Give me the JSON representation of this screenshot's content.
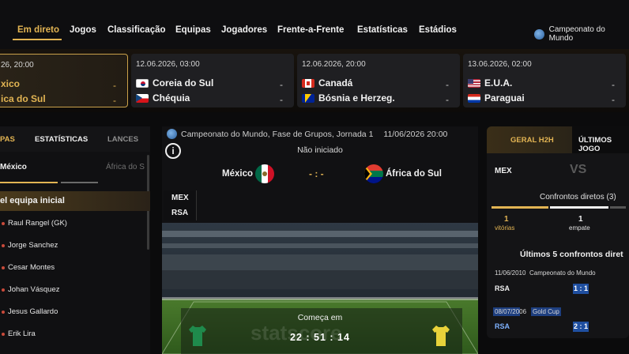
{
  "nav": {
    "items": [
      {
        "label": "Em direto",
        "active": true
      },
      {
        "label": "Jogos"
      },
      {
        "label": "Classificação"
      },
      {
        "label": "Equipas"
      },
      {
        "label": "Jogadores"
      },
      {
        "label": "Frente-a-Frente"
      },
      {
        "label": "Estatísticas"
      },
      {
        "label": "Estádios"
      }
    ],
    "competition": "Campeonato do Mundo"
  },
  "matches": [
    {
      "date": "26, 20:00",
      "home": "xico",
      "away": "ica do Sul",
      "home_score": "-",
      "away_score": "-",
      "active": true
    },
    {
      "date": "12.06.2026, 03:00",
      "home": "Coreia do Sul",
      "away": "Chéquia",
      "home_score": "-",
      "away_score": "-"
    },
    {
      "date": "12.06.2026, 20:00",
      "home": "Canadá",
      "away": "Bósnia e Herzeg.",
      "home_score": "-",
      "away_score": "-"
    },
    {
      "date": "13.06.2026, 02:00",
      "home": "E.U.A.",
      "away": "Paraguai",
      "home_score": "-",
      "away_score": "-"
    }
  ],
  "left_panel": {
    "tabs": [
      "PAS",
      "ESTATÍSTICAS",
      "LANCES"
    ],
    "team_home": "México",
    "team_away": "África do S",
    "lineup_heading": "el equipa inicial",
    "players": [
      "Raul Rangel (GK)",
      "Jorge Sanchez",
      "Cesar Montes",
      "Johan Vásquez",
      "Jesus Gallardo",
      "Erik Lira"
    ]
  },
  "center": {
    "header": "Campeonato do Mundo, Fase de Grupos, Jornada 1",
    "datetime": "11/06/2026 20:00",
    "status": "Não iniciado",
    "home_name": "México",
    "away_name": "África do Sul",
    "score": "- : -",
    "home_abbr": "MEX",
    "away_abbr": "RSA",
    "starts_label": "Começa em",
    "countdown": "22 : 51 : 14",
    "watermark": "statscore"
  },
  "right_panel": {
    "tab_active": "GERAL H2H",
    "tab_other": "ÚLTIMOS JOGO",
    "team": "MEX",
    "vs": "VS",
    "h2h_title": "Confrontos diretos (3)",
    "wins_num": "1",
    "wins_label": "vitórias",
    "draws_num": "1",
    "draws_label": "empate",
    "last5_title": "Últimos 5 confrontos diret",
    "results": [
      {
        "date": "11/06/2010",
        "competition": "Campeonato do Mundo",
        "team": "RSA",
        "score": "1 : 1"
      },
      {
        "date": "08/07/2006",
        "competition": "Gold Cup",
        "team": "RSA",
        "score": "2 : 1"
      }
    ]
  },
  "colors": {
    "accent": "#e2b453",
    "background": "#0b0b0c",
    "score_blue": "#1f4fa0"
  }
}
